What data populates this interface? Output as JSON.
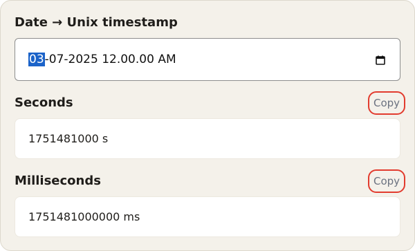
{
  "converter": {
    "title": "Date → Unix timestamp",
    "date_input": {
      "selected_segment": "03",
      "rest": "-07-2025 12.00.00 AM",
      "calendar_icon": "calendar-icon"
    },
    "seconds": {
      "label": "Seconds",
      "value": "1751481000 s",
      "copy_label": "Copy"
    },
    "milliseconds": {
      "label": "Milliseconds",
      "value": "1751481000000 ms",
      "copy_label": "Copy"
    }
  },
  "colors": {
    "card_background": "#f4f1ea",
    "selection": "#1b63c9",
    "copy_highlight": "#e23b2e",
    "copy_text": "#6b7280"
  }
}
